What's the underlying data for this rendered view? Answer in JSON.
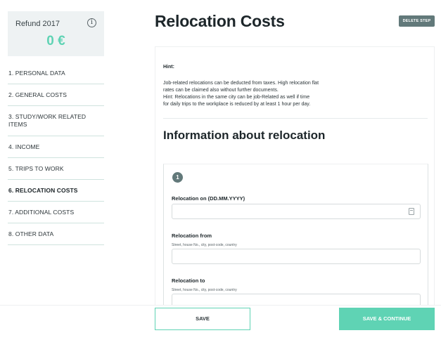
{
  "refund": {
    "title": "Refund 2017",
    "amount": "0 €",
    "info_icon": "i"
  },
  "sidebar": {
    "items": [
      {
        "label": "1. PERSONAL DATA",
        "active": false
      },
      {
        "label": "2. GENERAL COSTS",
        "active": false
      },
      {
        "label": "3. STUDY/WORK RELATED ITEMS",
        "active": false
      },
      {
        "label": "4. INCOME",
        "active": false
      },
      {
        "label": "5. TRIPS TO WORK",
        "active": false
      },
      {
        "label": "6. RELOCATION COSTS",
        "active": true
      },
      {
        "label": "7. ADDITIONAL COSTS",
        "active": false
      },
      {
        "label": "8. OTHER DATA",
        "active": false
      }
    ]
  },
  "header": {
    "title": "Relocation Costs",
    "delete_label": "DELETE STEP"
  },
  "hint": {
    "label": "Hint:",
    "lines": [
      "Job-related relocations can be deducted from taxes. High relocation flat",
      "rates can be claimed also without further documents.",
      "Hint: Relocations in the same city can be job-Related as well if time",
      "for daily trips to the workplace is reduced by at least 1 hour per day."
    ]
  },
  "section": {
    "title": "Information about relocation"
  },
  "form": {
    "step_number": "1",
    "relocation_on": {
      "label": "Relocation on (DD.MM.YYYY)",
      "value": ""
    },
    "relocation_from": {
      "label": "Relocation from",
      "hint": "Street, house No., city, post-code, country",
      "value": ""
    },
    "relocation_to": {
      "label": "Relocation to",
      "hint": "Street, house No., city, post-code, country",
      "value": ""
    }
  },
  "footer": {
    "save_label": "SAVE",
    "continue_label": "SAVE & CONTINUE"
  },
  "colors": {
    "accent": "#5fd3b4",
    "muted_button": "#62797a"
  }
}
